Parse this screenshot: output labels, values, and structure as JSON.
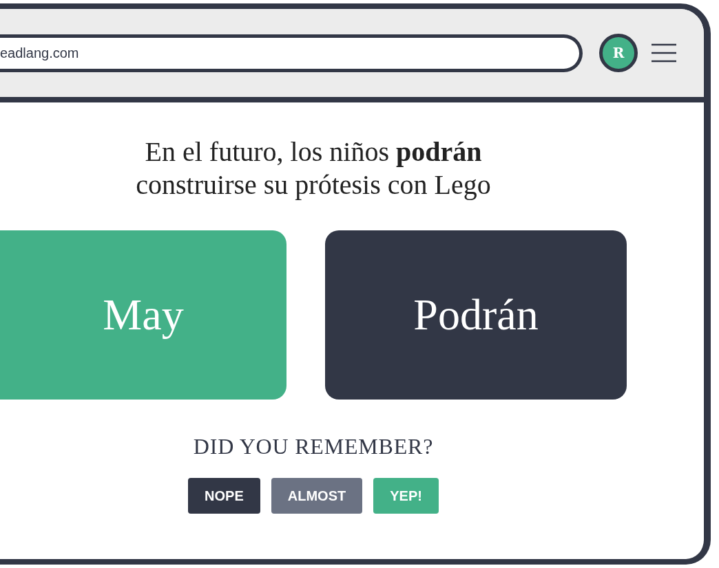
{
  "browser": {
    "address": "eadlang.com",
    "avatar": "R"
  },
  "sentence": "En el futuro, los niños **podrán** construirse su prótesis con Lego",
  "cards": [
    {
      "text": "May",
      "color": "#43b188"
    },
    {
      "text": "Podrán",
      "color": "#323746"
    }
  ],
  "prompt": "DID YOU REMEMBER?",
  "buttons": [
    {
      "label": "NOPE",
      "color": "#323746"
    },
    {
      "label": "ALMOST",
      "color": "#6b7283"
    },
    {
      "label": "YEP!",
      "color": "#43b188"
    }
  ]
}
